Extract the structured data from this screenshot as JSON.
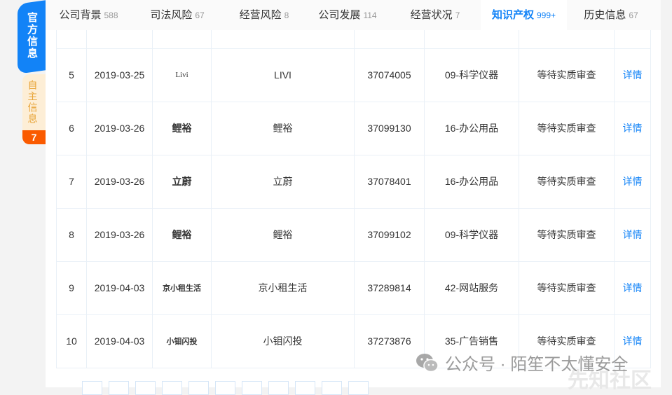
{
  "sidebar": {
    "official": "官方信息",
    "self": "自主信息",
    "self_count": "7"
  },
  "tabs": [
    {
      "label": "公司背景",
      "count": "588"
    },
    {
      "label": "司法风险",
      "count": "67"
    },
    {
      "label": "经营风险",
      "count": "8"
    },
    {
      "label": "公司发展",
      "count": "114"
    },
    {
      "label": "经营状况",
      "count": "7"
    },
    {
      "label": "知识产权",
      "count": "999+",
      "active": true
    },
    {
      "label": "历史信息",
      "count": "67"
    }
  ],
  "rows": [
    {
      "no": "5",
      "date": "2019-03-25",
      "image_text": "Livi",
      "name": "LIVI",
      "reg_no": "37074005",
      "category": "09-科学仪器",
      "status": "等待实质审查",
      "action": "详情"
    },
    {
      "no": "6",
      "date": "2019-03-26",
      "image_text": "鲤裕",
      "name": "鲤裕",
      "reg_no": "37099130",
      "category": "16-办公用品",
      "status": "等待实质审查",
      "action": "详情"
    },
    {
      "no": "7",
      "date": "2019-03-26",
      "image_text": "立蔚",
      "name": "立蔚",
      "reg_no": "37078401",
      "category": "16-办公用品",
      "status": "等待实质审查",
      "action": "详情"
    },
    {
      "no": "8",
      "date": "2019-03-26",
      "image_text": "鲤裕",
      "name": "鲤裕",
      "reg_no": "37099102",
      "category": "09-科学仪器",
      "status": "等待实质审查",
      "action": "详情"
    },
    {
      "no": "9",
      "date": "2019-04-03",
      "image_text": "京小租生活",
      "name": "京小租生活",
      "reg_no": "37289814",
      "category": "42-网站服务",
      "status": "等待实质审查",
      "action": "详情"
    },
    {
      "no": "10",
      "date": "2019-04-03",
      "image_text": "小钼闪投",
      "name": "小钼闪投",
      "reg_no": "37273876",
      "category": "35-广告销售",
      "status": "等待实质审查",
      "action": "详情"
    }
  ],
  "watermark": {
    "text": "公众号 · 陌笙不太懂安全",
    "text2": "先知社区"
  },
  "colors": {
    "accent": "#1283f7",
    "orange": "#fa5a00"
  }
}
